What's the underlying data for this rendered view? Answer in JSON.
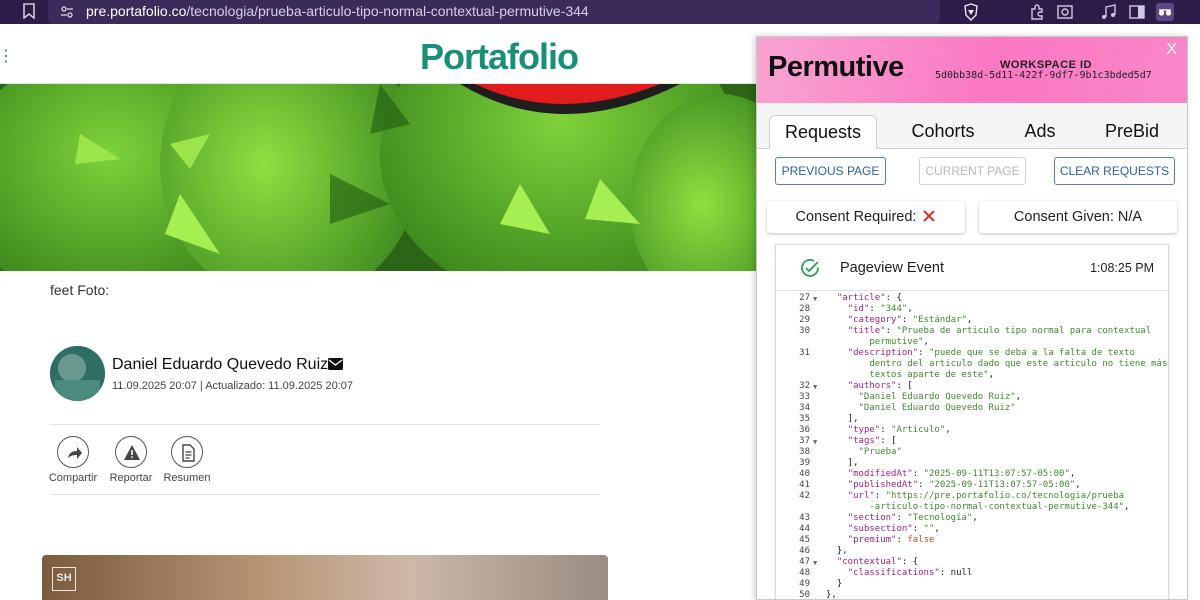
{
  "browser": {
    "url_host": "pre.portafolio.co",
    "url_path": "/tecnologia/prueba-articulo-tipo-normal-contextual-permutive-344",
    "icons": [
      "bookmark-icon",
      "site-info-icon",
      "brave-shield-icon",
      "extensions-icon",
      "screenshot-icon",
      "music-icon",
      "sidebar-icon",
      "incognito-icon"
    ]
  },
  "site": {
    "logo": "Portafolio",
    "caption": "feet Foto:",
    "author_name": "Daniel Eduardo Quevedo Ruiz",
    "published": "11.09.2025 20:07",
    "separator": "|",
    "updated": "Actualizado: 11.09.2025 20:07",
    "actions": {
      "share": "Compartir",
      "report": "Reportar",
      "summary": "Resumen"
    },
    "video_badge": "SH"
  },
  "permutive": {
    "logo": "Permutive",
    "workspace_label": "WORKSPACE ID",
    "workspace_id": "5d0bb38d-5d11-422f-9df7-9b1c3bded5d7",
    "close": "X",
    "tabs": [
      "Requests",
      "Cohorts",
      "Ads",
      "PreBid"
    ],
    "active_tab": "Requests",
    "buttons": {
      "previous": "PREVIOUS PAGE",
      "current": "CURRENT PAGE",
      "clear": "CLEAR REQUESTS"
    },
    "consent_required": "Consent Required:",
    "consent_given": "Consent Given: N/A",
    "event": {
      "title": "Pageview Event",
      "time": "1:08:25 PM"
    },
    "code_lines": [
      {
        "n": "27",
        "fold": true,
        "t": "  <k>\"article\"</k>: {"
      },
      {
        "n": "28",
        "fold": false,
        "t": "    <k>\"id\"</k>: <s>\"344\"</s>,"
      },
      {
        "n": "29",
        "fold": false,
        "t": "    <k>\"category\"</k>: <s>\"Estándar\"</s>,"
      },
      {
        "n": "30",
        "fold": false,
        "t": "    <k>\"title\"</k>: <s>\"Prueba de articulo tipo normal para contextual</s>"
      },
      {
        "n": "",
        "fold": false,
        "t": "        <s>permutive\"</s>,"
      },
      {
        "n": "31",
        "fold": false,
        "t": "    <k>\"description\"</k>: <s>\"puede que se deba a la falta de texto</s>"
      },
      {
        "n": "",
        "fold": false,
        "t": "        <s>dentro del articulo dado que este articulo no tiene más</s>"
      },
      {
        "n": "",
        "fold": false,
        "t": "        <s>textos aparte de este\"</s>,"
      },
      {
        "n": "32",
        "fold": true,
        "t": "    <k>\"authors\"</k>: ["
      },
      {
        "n": "33",
        "fold": false,
        "t": "      <s>\"Daniel Eduardo Quevedo Ruiz\"</s>,"
      },
      {
        "n": "34",
        "fold": false,
        "t": "      <s>\"Daniel Eduardo Quevedo Ruiz\"</s>"
      },
      {
        "n": "35",
        "fold": false,
        "t": "    ],"
      },
      {
        "n": "36",
        "fold": false,
        "t": "    <k>\"type\"</k>: <s>\"Articulo\"</s>,"
      },
      {
        "n": "37",
        "fold": true,
        "t": "    <k>\"tags\"</k>: ["
      },
      {
        "n": "38",
        "fold": false,
        "t": "      <s>\"Prueba\"</s>"
      },
      {
        "n": "39",
        "fold": false,
        "t": "    ],"
      },
      {
        "n": "40",
        "fold": false,
        "t": "    <k>\"modifiedAt\"</k>: <s>\"2025-09-11T13:07:57-05:00\"</s>,"
      },
      {
        "n": "41",
        "fold": false,
        "t": "    <k>\"publishedAt\"</k>: <s>\"2025-09-11T13:07:57-05:00\"</s>,"
      },
      {
        "n": "42",
        "fold": false,
        "t": "    <k>\"url\"</k>: <s>\"https://pre.portafolio.co/tecnologia/prueba</s>"
      },
      {
        "n": "",
        "fold": false,
        "t": "        <s>-articulo-tipo-normal-contextual-permutive-344\"</s>,"
      },
      {
        "n": "43",
        "fold": false,
        "t": "    <k>\"section\"</k>: <s>\"Tecnología\"</s>,"
      },
      {
        "n": "44",
        "fold": false,
        "t": "    <k>\"subsection\"</k>: <s>\"\"</s>,"
      },
      {
        "n": "45",
        "fold": false,
        "t": "    <k>\"premium\"</k>: <b>false</b>"
      },
      {
        "n": "46",
        "fold": false,
        "t": "  },"
      },
      {
        "n": "47",
        "fold": true,
        "t": "  <k>\"contextual\"</k>: {"
      },
      {
        "n": "48",
        "fold": false,
        "t": "    <k>\"classifications\"</k>: null"
      },
      {
        "n": "49",
        "fold": false,
        "t": "  }"
      },
      {
        "n": "50",
        "fold": false,
        "t": "},"
      }
    ]
  },
  "colors": {
    "portafolio_green": "#1a8f78",
    "permutive_pink": "#fb77c2",
    "button_blue": "#2f5ea6",
    "error_red": "#e0312f",
    "success_green": "#2e9e55"
  }
}
